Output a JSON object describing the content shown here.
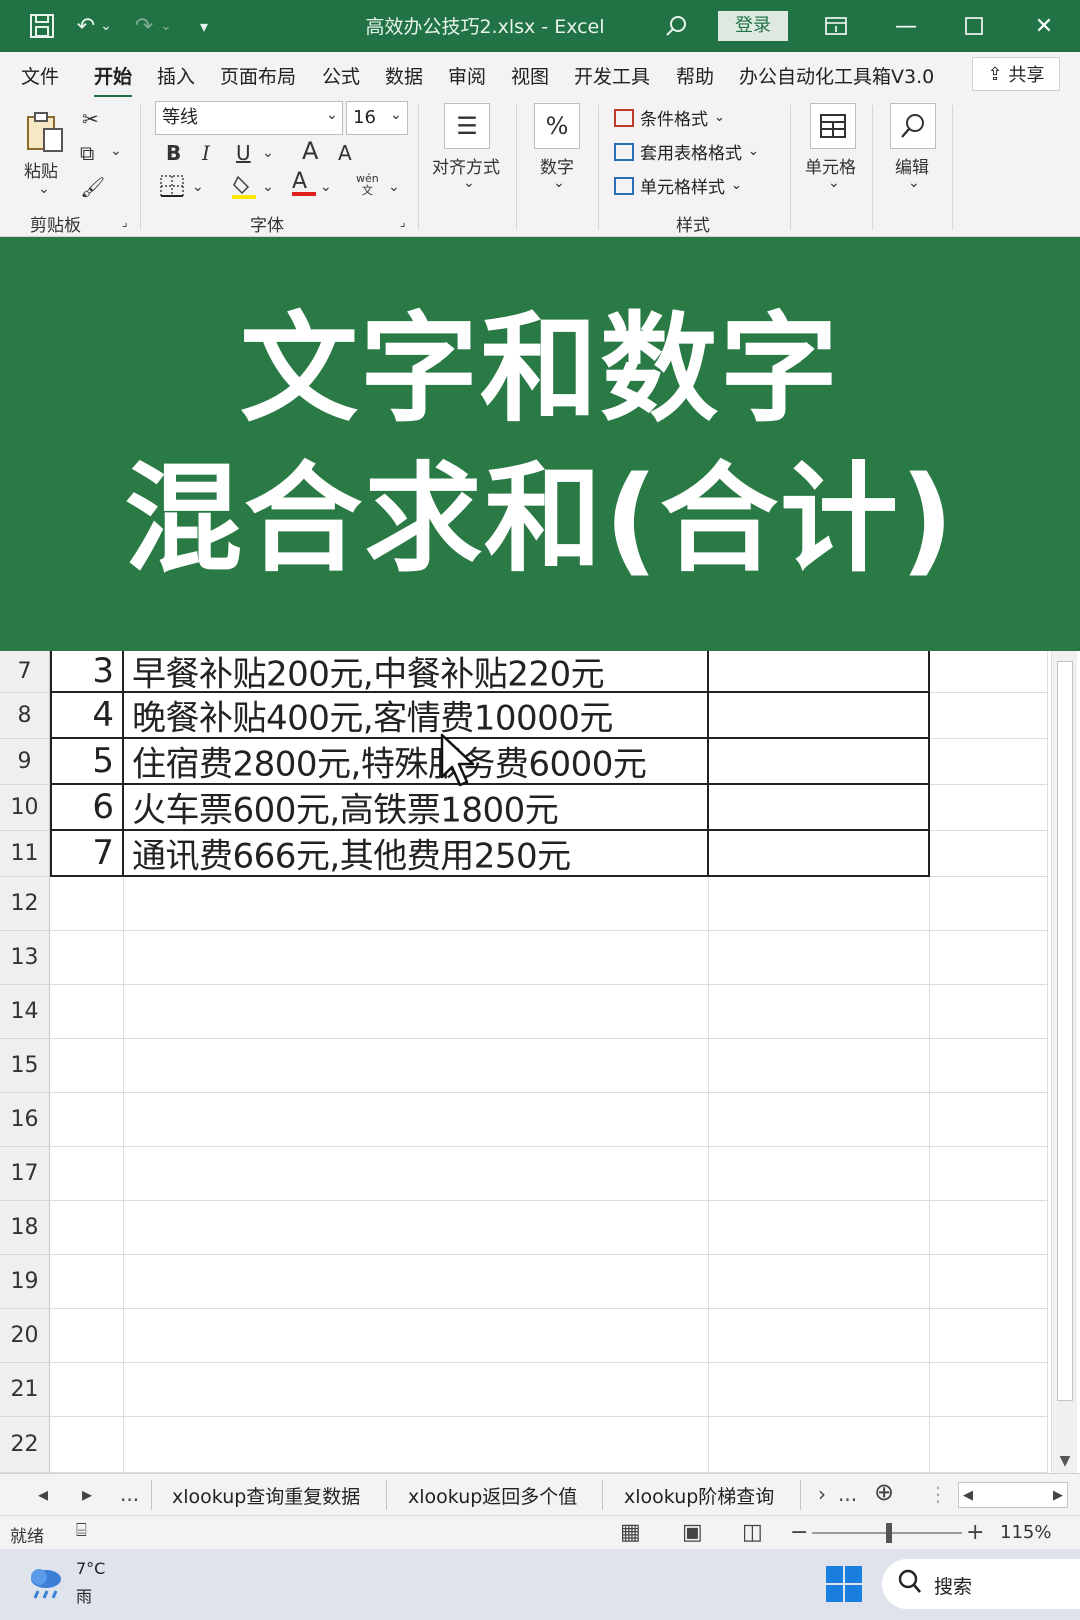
{
  "titlebar": {
    "title": "高效办公技巧2.xlsx  -  Excel",
    "login": "登录",
    "accent": "#217346"
  },
  "menu": {
    "tabs": [
      "文件",
      "开始",
      "插入",
      "页面布局",
      "公式",
      "数据",
      "审阅",
      "视图",
      "开发工具",
      "帮助",
      "办公自动化工具箱V3.0"
    ],
    "active": "开始",
    "share": "共享"
  },
  "ribbon": {
    "paste": "粘贴",
    "clipboard_group": "剪贴板",
    "font_name": "等线",
    "font_size": "16",
    "bold": "B",
    "italic": "I",
    "underline": "U",
    "grow_font": "A",
    "shrink_font": "A",
    "font_color_letter": "A",
    "pinyin": "wén",
    "pinyin_sub": "文",
    "font_group": "字体",
    "align_label": "对齐方式",
    "number_label": "数字",
    "number_symbol": "%",
    "conditional_format": "条件格式",
    "table_format": "套用表格格式",
    "cell_style": "单元格样式",
    "styles_group": "样式",
    "cells_label": "单元格",
    "editing_label": "编辑"
  },
  "banner": {
    "line1": "文字和数字",
    "line2": "混合求和(合计)",
    "bg": "#2a7a45"
  },
  "grid": {
    "data_rows": [
      {
        "row": "7",
        "index": "3",
        "text": "早餐补贴200元,中餐补贴220元"
      },
      {
        "row": "8",
        "index": "4",
        "text": "晚餐补贴400元,客情费10000元"
      },
      {
        "row": "9",
        "index": "5",
        "text": "住宿费2800元,特殊服务费6000元"
      },
      {
        "row": "10",
        "index": "6",
        "text": "火车票600元,高铁票1800元"
      },
      {
        "row": "11",
        "index": "7",
        "text": "通讯费666元,其他费用250元"
      }
    ],
    "empty_rows": [
      "12",
      "13",
      "14",
      "15",
      "16",
      "17",
      "18",
      "19",
      "20",
      "21",
      "22"
    ]
  },
  "sheets": {
    "tabs": [
      "xlookup查询重复数据",
      "xlookup返回多个值",
      "xlookup阶梯查询"
    ],
    "more": "..."
  },
  "status": {
    "ready": "就绪",
    "zoom": "115%",
    "zoom_minus": "−",
    "zoom_plus": "+"
  },
  "taskbar": {
    "temp": "7°C",
    "weather": "雨",
    "search": "搜索"
  }
}
